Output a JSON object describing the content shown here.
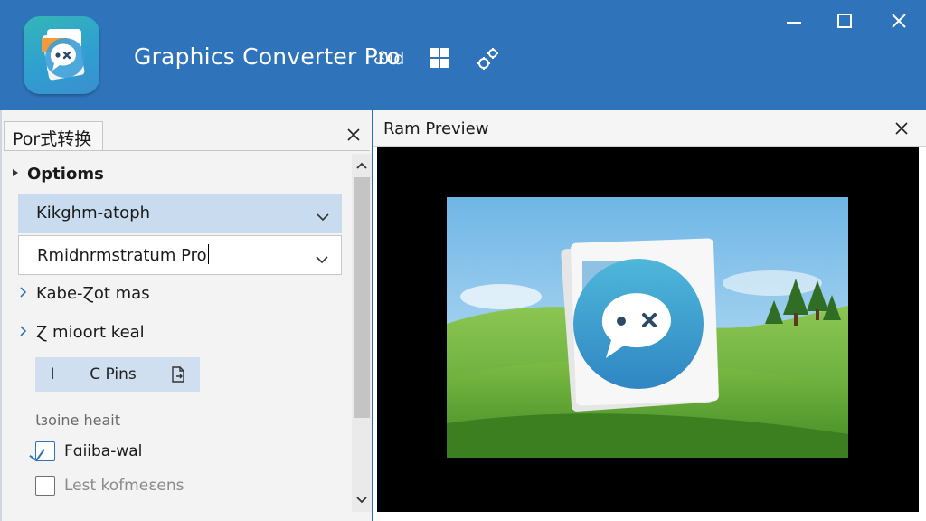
{
  "app": {
    "title": "Graphics Converter Pro",
    "toolbar_text": "Ꮚid"
  },
  "left_panel": {
    "tab_label": "Por式转换",
    "section_title": "Optioms",
    "dropdown1_value": "Kikghm-atoph",
    "dropdown2_value": "Rmidnrmstratum Pro",
    "tree_items": [
      {
        "label": "Kabe-Ɀot mas"
      },
      {
        "label": "Ɀ mioort keal"
      }
    ],
    "tools": {
      "tool1": "I",
      "tool2": "C  Pins"
    },
    "static_label": "Ɩɜoine heait",
    "checkbox1": {
      "label": "Fɑiiba-wal",
      "checked": true
    },
    "checkbox2": {
      "label": "Lest kofmeɛens",
      "checked": false
    }
  },
  "preview_panel": {
    "title": "Ram Preview"
  },
  "colors": {
    "titlebar": "#2f74ba",
    "accent": "#2f74ba",
    "selected_dropdown": "#c9dbee"
  }
}
